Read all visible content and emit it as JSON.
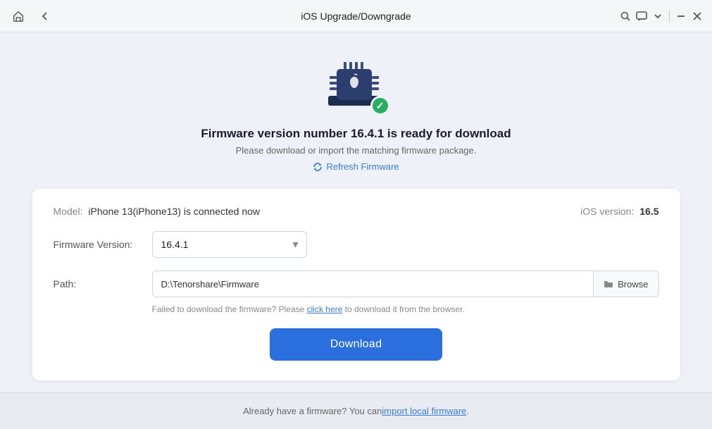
{
  "titleBar": {
    "title": "iOS Upgrade/Downgrade",
    "homeIcon": "home",
    "backIcon": "back",
    "searchIcon": "search",
    "chatIcon": "chat",
    "chevronIcon": "chevron-down",
    "minimizeIcon": "minimize",
    "closeIcon": "close"
  },
  "hero": {
    "title": "Firmware version number 16.4.1 is ready for download",
    "subtitle": "Please download or import the matching firmware package.",
    "refreshLabel": "Refresh Firmware"
  },
  "card": {
    "modelLabel": "Model:",
    "modelValue": "iPhone 13(iPhone13) is connected now",
    "iosLabel": "iOS version:",
    "iosValue": "16.5",
    "firmwareLabel": "Firmware Version:",
    "firmwareValue": "16.4.1",
    "pathLabel": "Path:",
    "pathValue": "D:\\Tenorshare\\Firmware",
    "browseLabel": "Browse",
    "failNote": "Failed to download the firmware? Please ",
    "clickHereLabel": "click here",
    "failNoteEnd": " to download it from the browser.",
    "downloadLabel": "Download"
  },
  "footer": {
    "text": "Already have a firmware? You can ",
    "linkLabel": "import local firmware",
    "textEnd": "."
  }
}
